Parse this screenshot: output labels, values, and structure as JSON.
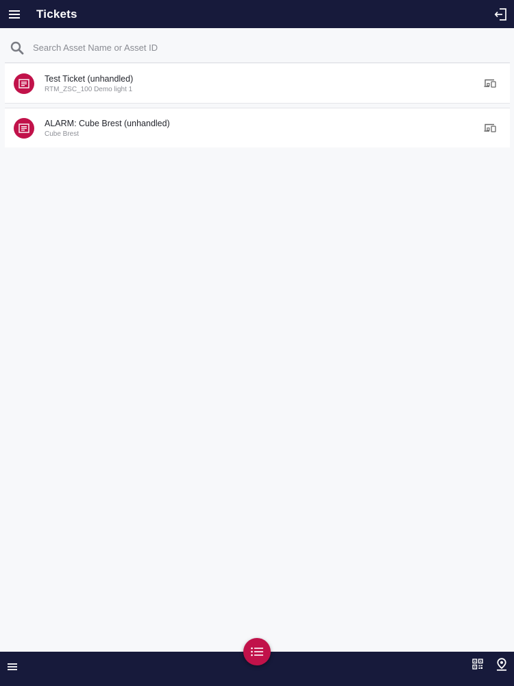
{
  "colors": {
    "topbar": "#171a3b",
    "accent": "#c1124a",
    "background": "#f7f8fa"
  },
  "header": {
    "title": "Tickets",
    "menu_icon": "hamburger-menu-icon",
    "logout_icon": "logout-icon"
  },
  "search": {
    "placeholder": "Search Asset Name or Asset ID",
    "value": "",
    "icon": "search-icon"
  },
  "tickets": [
    {
      "title": "Test Ticket (unhandled)",
      "subtitle": "RTM_ZSC_100 Demo light 1",
      "icon": "ticket-icon",
      "action_icon": "devices-icon"
    },
    {
      "title": "ALARM: Cube Brest (unhandled)",
      "subtitle": "Cube Brest",
      "icon": "ticket-icon",
      "action_icon": "devices-icon"
    }
  ],
  "bottombar": {
    "menu_icon": "hamburger-menu-icon",
    "qr_icon": "qr-code-icon",
    "location_icon": "location-pin-icon"
  },
  "fab": {
    "icon": "list-icon"
  }
}
